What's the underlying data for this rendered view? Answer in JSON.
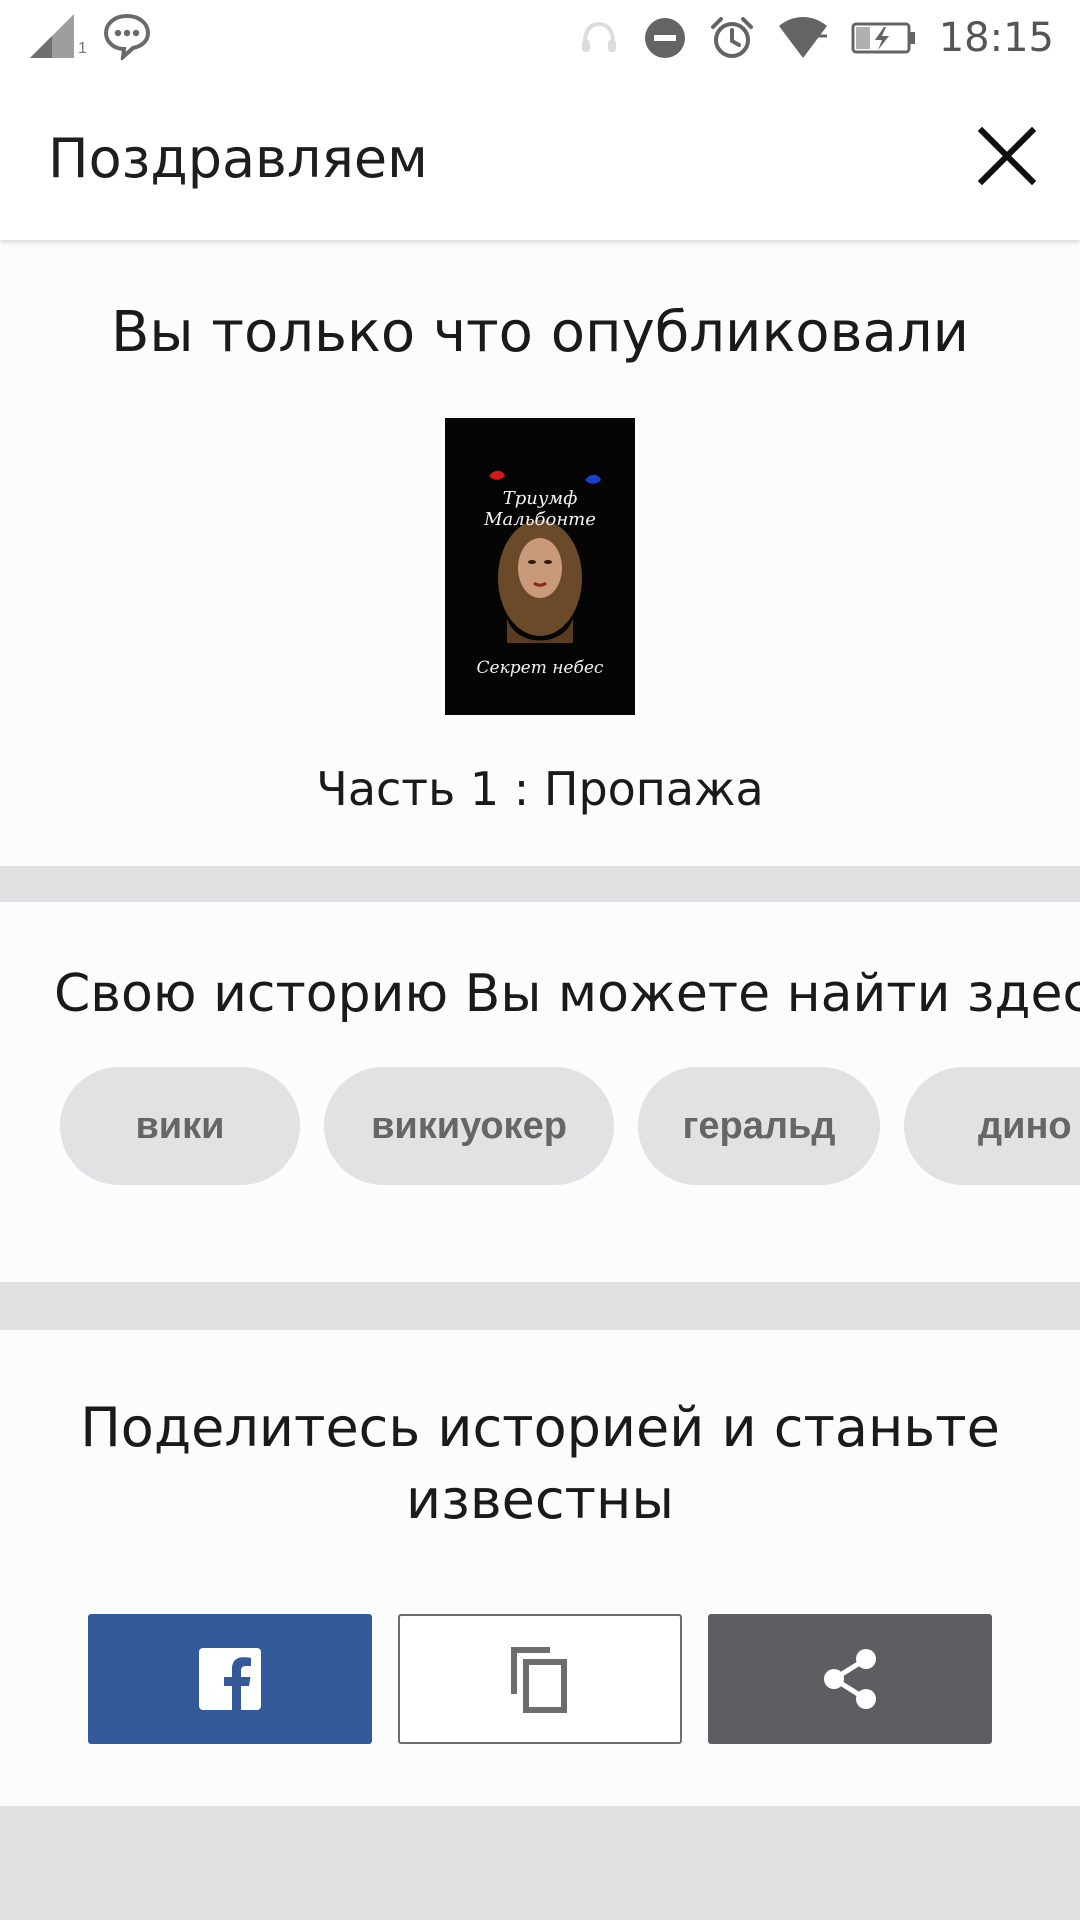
{
  "status_bar": {
    "time": "18:15",
    "sim_label": "1",
    "icons": [
      "signal-icon",
      "message-bubble-icon",
      "headset-icon",
      "do-not-disturb-icon",
      "alarm-icon",
      "wifi-icon",
      "battery-charging-icon"
    ]
  },
  "header": {
    "title": "Поздравляем",
    "close_icon": "close-icon"
  },
  "published": {
    "heading": "Вы только что опубликовали",
    "cover": {
      "title": "Триумф Мальбонте",
      "subtitle": "Секрет небес"
    },
    "chapter": "Часть 1 : Пропажа"
  },
  "find": {
    "heading": "Свою историю Вы можете найти здесь",
    "tags": [
      "вики",
      "викиуокер",
      "геральд",
      "дино"
    ]
  },
  "share": {
    "heading_line1": "Поделитесь историей и станьте",
    "heading_line2": "известны",
    "buttons": [
      {
        "name": "facebook",
        "icon": "facebook-icon",
        "color": "#355a9a"
      },
      {
        "name": "copy-link",
        "icon": "copy-icon",
        "color": "#ffffff"
      },
      {
        "name": "share",
        "icon": "share-icon",
        "color": "#5e5d61"
      }
    ]
  }
}
